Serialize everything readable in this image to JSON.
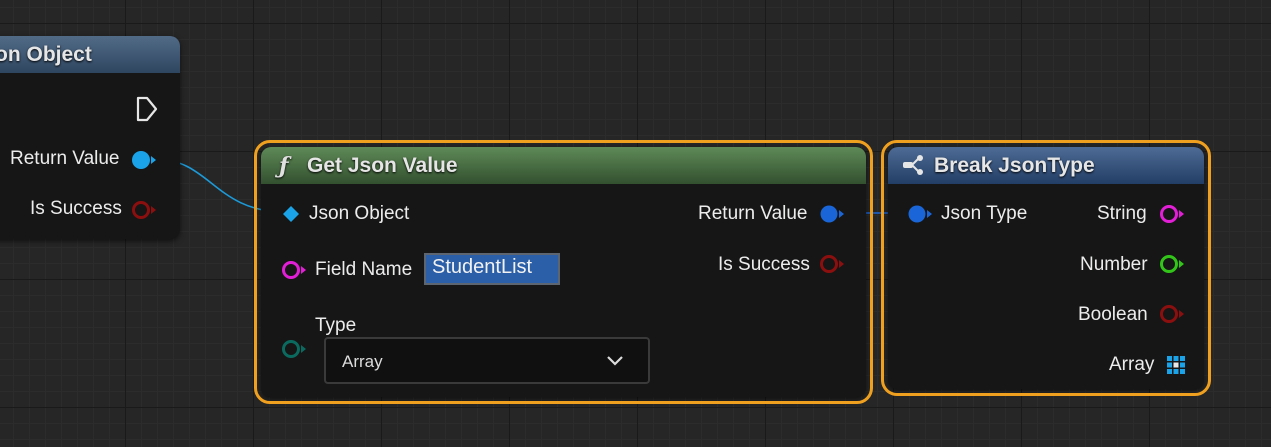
{
  "left_node": {
    "title_fragment": "on Object",
    "pins": {
      "return_value": "Return Value",
      "is_success": "Is Success"
    }
  },
  "get_json_value": {
    "func_icon": "ƒ",
    "title": "Get Json Value",
    "inputs": {
      "json_object": "Json Object",
      "field_name": "Field Name",
      "type": "Type"
    },
    "field_name_value": "StudentList",
    "type_value": "Array",
    "outputs": {
      "return_value": "Return Value",
      "is_success": "Is Success"
    }
  },
  "break_json_type": {
    "title": "Break JsonType",
    "inputs": {
      "json_type": "Json Type"
    },
    "outputs": {
      "string": "String",
      "number": "Number",
      "boolean": "Boolean",
      "array": "Array"
    }
  },
  "colors": {
    "selection": "#f0a01f",
    "exec_pin": "#e6e6e6",
    "struct_pin": "#1aa3e8",
    "object_pin": "#1a66d8",
    "bool_pin": "#8c0f0f",
    "string_pin": "#e21fd6",
    "number_pin": "#33c41a",
    "enum_pin": "#0b6a5f",
    "wire": "#1c9ad8"
  }
}
